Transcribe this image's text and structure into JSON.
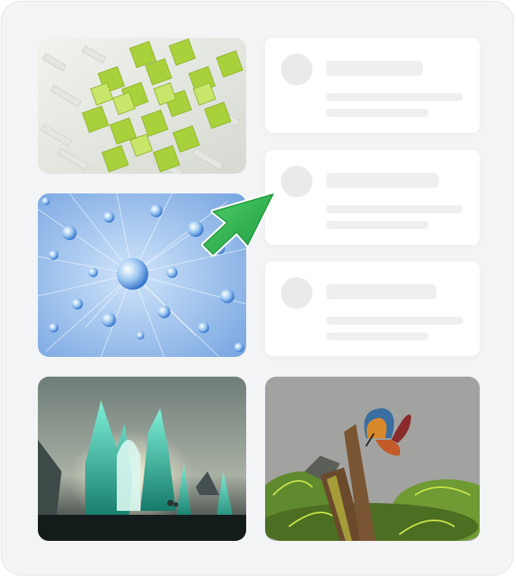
{
  "gallery": {
    "tiles": [
      {
        "icon": "abstract-green-cubes-image"
      },
      {
        "icon": "blue-crystal-molecule-image"
      },
      {
        "icon": "ice-castle-landscape-image"
      },
      {
        "icon": "butterfly-on-stump-image"
      }
    ]
  },
  "placeholder_cards": [
    {
      "state": "loading"
    },
    {
      "state": "loading"
    },
    {
      "state": "loading"
    }
  ],
  "cursor": {
    "icon": "pointer-arrow-icon",
    "color": "#2eb84f"
  },
  "colors": {
    "panel": "#f3f4f6",
    "card": "#ffffff",
    "skeleton": "#eeeff1",
    "accent": "#2eb84f"
  }
}
